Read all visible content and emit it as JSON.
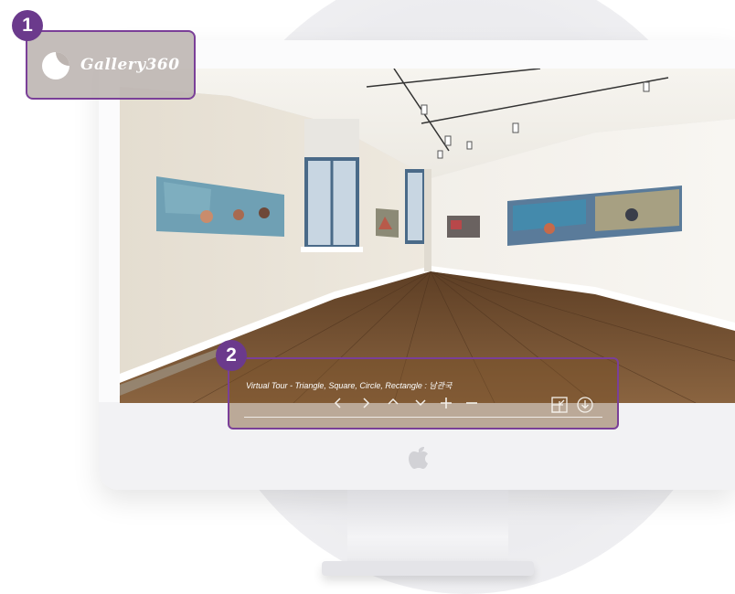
{
  "brand": {
    "name": "Gallery360"
  },
  "callouts": {
    "brand_number": "1",
    "tour_number": "2"
  },
  "tour": {
    "title": "Virtual Tour - Triangle, Square, Circle, Rectangle : 남관국",
    "controls": [
      {
        "name": "previous",
        "icon": "chevron-left-icon"
      },
      {
        "name": "next",
        "icon": "chevron-right-icon"
      },
      {
        "name": "look-up",
        "icon": "chevron-up-icon"
      },
      {
        "name": "look-down",
        "icon": "chevron-down-icon"
      },
      {
        "name": "zoom-in",
        "icon": "plus-icon"
      },
      {
        "name": "zoom-out",
        "icon": "minus-icon"
      },
      {
        "name": "fullscreen",
        "icon": "fullscreen-exit-icon"
      },
      {
        "name": "download",
        "icon": "download-circle-icon"
      }
    ]
  },
  "colors": {
    "accent": "#7a3f98",
    "badge": "#6b3a8c",
    "floor": "#7a5232",
    "wall": "#ece8e0"
  }
}
